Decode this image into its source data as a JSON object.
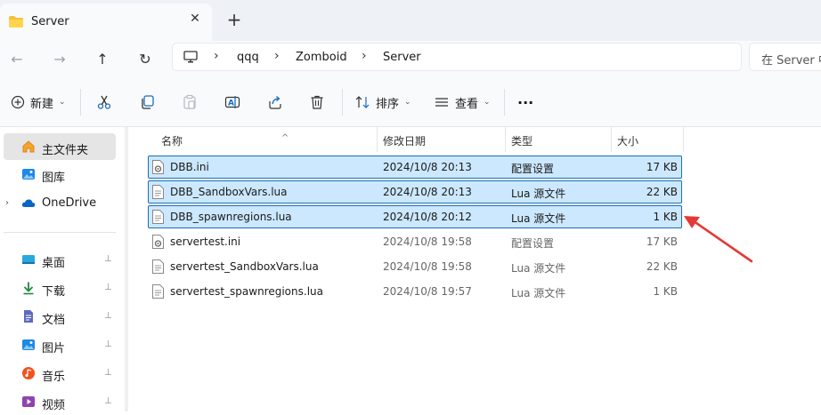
{
  "window": {
    "tab_title": "Server",
    "close_glyph": "✕",
    "newtab_glyph": "+"
  },
  "nav": {
    "back_glyph": "←",
    "forward_glyph": "→",
    "up_glyph": "↑",
    "refresh_glyph": "↻",
    "breadcrumbs": [
      "qqq",
      "Zomboid",
      "Server"
    ],
    "sep_glyph": "›",
    "search_placeholder": "在 Server 中"
  },
  "toolbar": {
    "new_label": "新建",
    "sort_label": "排序",
    "view_label": "查看",
    "more_glyph": "···"
  },
  "sidebar": {
    "items": [
      {
        "label": "主文件夹",
        "icon": "home-icon"
      },
      {
        "label": "图库",
        "icon": "gallery-icon"
      },
      {
        "label": "OneDrive",
        "icon": "onedrive-icon"
      },
      {
        "label": "桌面",
        "icon": "desktop-icon"
      },
      {
        "label": "下载",
        "icon": "download-icon"
      },
      {
        "label": "文档",
        "icon": "documents-icon"
      },
      {
        "label": "图片",
        "icon": "pictures-icon"
      },
      {
        "label": "音乐",
        "icon": "music-icon"
      },
      {
        "label": "视频",
        "icon": "videos-icon"
      }
    ],
    "pin_glyph": "📌",
    "expander_glyph": "›"
  },
  "filelist": {
    "columns": {
      "name": "名称",
      "date": "修改日期",
      "type": "类型",
      "size": "大小"
    },
    "files": [
      {
        "name": "DBB.ini",
        "date": "2024/10/8 20:13",
        "type": "配置设置",
        "size": "17 KB",
        "selected": true,
        "icon": "config-file-icon"
      },
      {
        "name": "DBB_SandboxVars.lua",
        "date": "2024/10/8 20:13",
        "type": "Lua 源文件",
        "size": "22 KB",
        "selected": true,
        "icon": "text-file-icon"
      },
      {
        "name": "DBB_spawnregions.lua",
        "date": "2024/10/8 20:12",
        "type": "Lua 源文件",
        "size": "1 KB",
        "selected": true,
        "icon": "text-file-icon"
      },
      {
        "name": "servertest.ini",
        "date": "2024/10/8 19:58",
        "type": "配置设置",
        "size": "17 KB",
        "selected": false,
        "icon": "config-file-icon"
      },
      {
        "name": "servertest_SandboxVars.lua",
        "date": "2024/10/8 19:58",
        "type": "Lua 源文件",
        "size": "22 KB",
        "selected": false,
        "icon": "text-file-icon"
      },
      {
        "name": "servertest_spawnregions.lua",
        "date": "2024/10/8 19:57",
        "type": "Lua 源文件",
        "size": "1 KB",
        "selected": false,
        "icon": "text-file-icon"
      }
    ]
  },
  "colors": {
    "selection_fill": "#cce8ff",
    "selection_border": "#1a6fb8",
    "annotation_arrow": "#e53935"
  }
}
